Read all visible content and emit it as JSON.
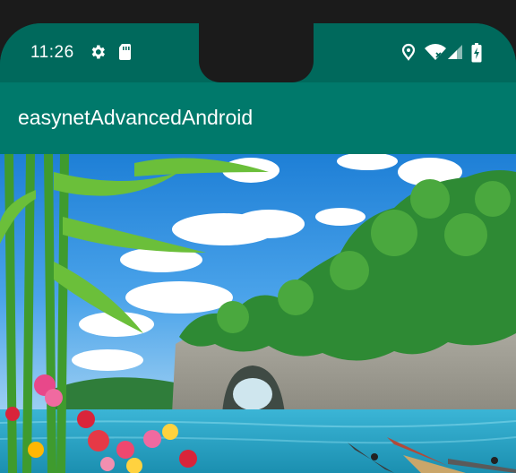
{
  "status_bar": {
    "time": "11:26",
    "left_icons": [
      "settings-icon",
      "sim-card-icon"
    ],
    "right_icons": [
      "location-icon",
      "wifi-icon",
      "signal-icon",
      "battery-icon"
    ]
  },
  "app_bar": {
    "title": "easynetAdvancedAndroid",
    "color": "#00796b"
  },
  "colors": {
    "status_bar": "#00695c",
    "app_bar": "#00796b"
  },
  "content": {
    "image": "landscape-photo"
  }
}
